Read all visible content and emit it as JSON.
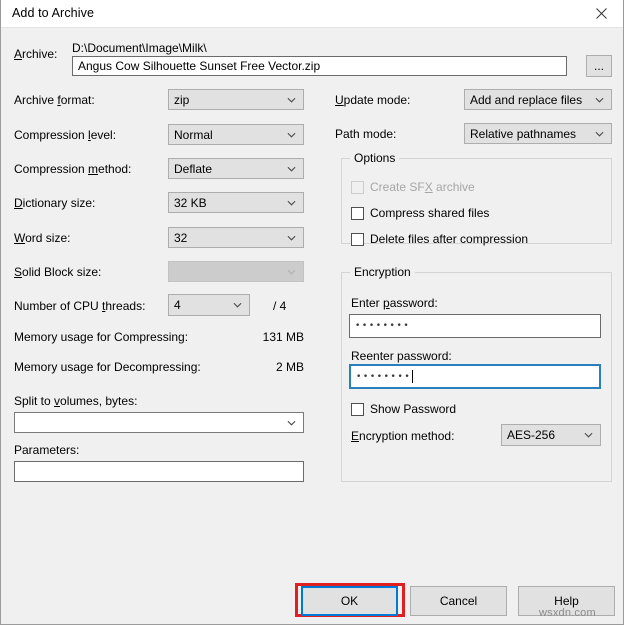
{
  "window": {
    "title": "Add to Archive",
    "close_icon": "close-icon"
  },
  "archive": {
    "label": "Archive:",
    "label_accel": "A",
    "path_text": "D:\\Document\\Image\\Milk\\",
    "filename_value": "Angus Cow Silhouette Sunset Free Vector.zip",
    "browse_label": "..."
  },
  "left_column": {
    "archive_format": {
      "label": "Archive format:",
      "accel": "f",
      "value": "zip"
    },
    "compression_level": {
      "label": "Compression level:",
      "accel": "l",
      "value": "Normal"
    },
    "compression_method": {
      "label": "Compression method:",
      "accel": "m",
      "value": "Deflate"
    },
    "dictionary_size": {
      "label": "Dictionary size:",
      "accel": "D",
      "value": "32 KB"
    },
    "word_size": {
      "label": "Word size:",
      "accel": "W",
      "value": "32"
    },
    "solid_block_size": {
      "label": "Solid Block size:",
      "accel": "S",
      "value": "",
      "disabled": true
    },
    "cpu_threads": {
      "label": "Number of CPU threads:",
      "accel": "t",
      "value": "4",
      "total": "/ 4"
    },
    "memory_compress": {
      "label": "Memory usage for Compressing:",
      "value": "131 MB"
    },
    "memory_decompress": {
      "label": "Memory usage for Decompressing:",
      "value": "2 MB"
    },
    "split_volumes": {
      "label": "Split to volumes, bytes:",
      "accel": "v",
      "value": ""
    },
    "parameters": {
      "label": "Parameters:",
      "value": ""
    }
  },
  "right_column": {
    "update_mode": {
      "label": "Update mode:",
      "accel": "U",
      "value": "Add and replace files"
    },
    "path_mode": {
      "label": "Path mode:",
      "value": "Relative pathnames"
    }
  },
  "options_group": {
    "title": "Options",
    "items": [
      {
        "label_pre": "Create SF",
        "accel": "X",
        "label_post": " archive",
        "checked": false,
        "disabled": true
      },
      {
        "label_pre": "Compress shared files",
        "accel": "",
        "label_post": "",
        "checked": false,
        "disabled": false
      },
      {
        "label_pre": "Delete files after compression",
        "accel": "",
        "label_post": "",
        "checked": false,
        "disabled": false
      }
    ]
  },
  "encryption_group": {
    "title": "Encryption",
    "enter_password": {
      "label": "Enter password:",
      "accel": "p",
      "value": "••••••••",
      "dots": 8
    },
    "reenter_password": {
      "label": "Reenter password:",
      "accel": "",
      "value": "••••••••",
      "dots": 8,
      "focused": true
    },
    "show_password": {
      "label": "Show Password",
      "checked": false
    },
    "encryption_method": {
      "label": "Encryption method:",
      "accel": "E",
      "value": "AES-256"
    }
  },
  "buttons": {
    "ok": "OK",
    "cancel": "Cancel",
    "help": "Help"
  },
  "watermark": "wsxdn.com",
  "colors": {
    "dialog_bg": "#f0f0f0",
    "titlebar_bg": "#ffffff",
    "combo_bg": "#e1e1e1",
    "focus_blue": "#0078d7",
    "annotation_red": "#e02020",
    "disabled_text": "#a6a6a6"
  }
}
